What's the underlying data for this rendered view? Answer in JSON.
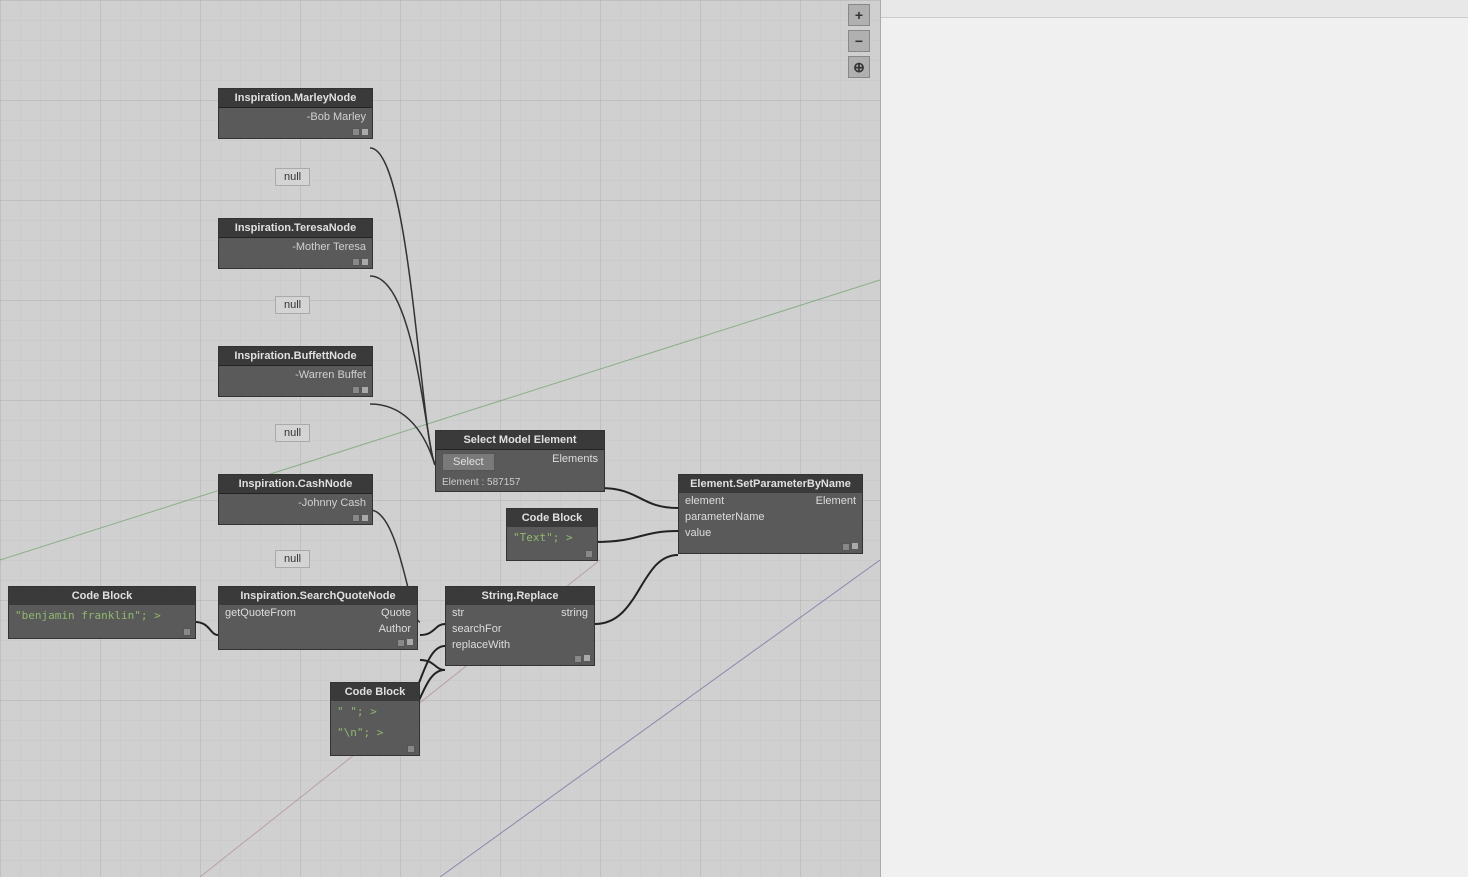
{
  "toolbar": {
    "zoom_in": "+",
    "zoom_out": "−",
    "fit": "⊕"
  },
  "nodes": {
    "marley": {
      "header": "Inspiration.MarleyNode",
      "body": "-Bob Marley",
      "null_label": "null"
    },
    "teresa": {
      "header": "Inspiration.TeresaNode",
      "body": "-Mother Teresa",
      "null_label": "null"
    },
    "buffett": {
      "header": "Inspiration.BuffettNode",
      "body": "-Warren Buffet",
      "null_label": "null"
    },
    "cash": {
      "header": "Inspiration.CashNode",
      "body": "-Johnny Cash",
      "null_label": "null"
    },
    "code_block_main": {
      "header": "Code Block",
      "body": "\"benjamin franklin\"; >"
    },
    "select_model": {
      "header": "Select Model Element",
      "select_label": "Select",
      "elements_label": "Elements",
      "element_value": "Element : 587157"
    },
    "code_block_text": {
      "header": "Code Block",
      "line1": "\"Text\";  >"
    },
    "string_replace": {
      "header": "String.Replace",
      "port1": "str",
      "port1_out": "string",
      "port2": "searchFor",
      "port3": "replaceWith"
    },
    "set_param": {
      "header": "Element.SetParameterByName",
      "port1_in": "element",
      "port1_out": "Element",
      "port2_in": "parameterName",
      "port3_in": "value"
    },
    "search_quote": {
      "header": "Inspiration.SearchQuoteNode",
      "port1_in": "getQuoteFrom",
      "port1_out": "Quote",
      "port2_out": "Author"
    },
    "code_block_small": {
      "header": "Code Block",
      "line1": "\" \";  >",
      "line2": "\"\\n\"; >"
    }
  }
}
